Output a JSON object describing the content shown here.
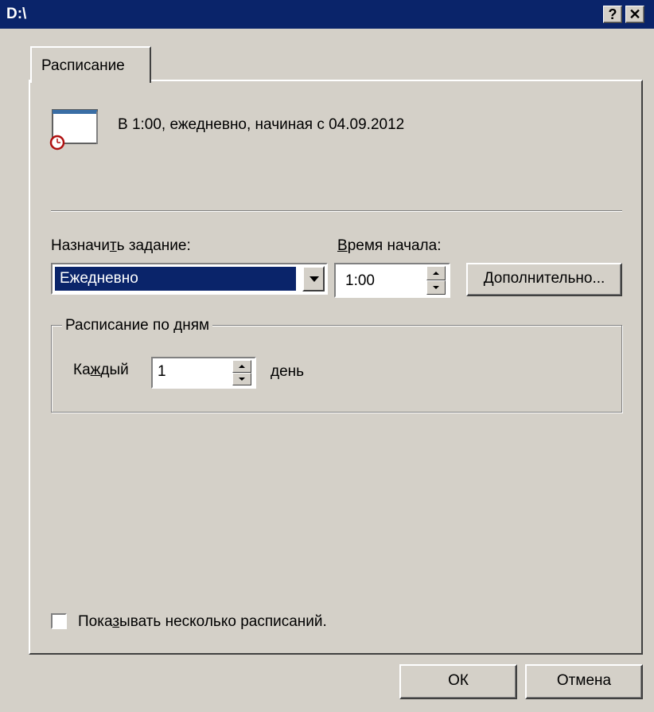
{
  "window": {
    "title": "D:\\",
    "help_label": "?",
    "close_label": "✕"
  },
  "tabs": [
    {
      "label": "Расписание"
    }
  ],
  "summary": {
    "text": "В 1:00, ежедневно, начиная с 04.09.2012",
    "icon": "schedule-clock-icon"
  },
  "assign": {
    "label_before": "Назначи",
    "label_accel": "т",
    "label_after": "ь задание:",
    "value": "Ежедневно"
  },
  "start_time": {
    "label_accel": "В",
    "label_after": "ремя начала:",
    "value": "1:00"
  },
  "advanced": {
    "label_accel": "Д",
    "label_after": "ополнительно..."
  },
  "daily": {
    "group_title": "Расписание по дням",
    "every_before": "Ка",
    "every_accel": "ж",
    "every_after": "дый",
    "every_value": "1",
    "unit": "день"
  },
  "multiple": {
    "label_before": "Пока",
    "label_accel": "з",
    "label_after": "ывать несколько расписаний.",
    "checked": false
  },
  "buttons": {
    "ok": "ОК",
    "cancel": "Отмена"
  },
  "colors": {
    "titlebar": "#0a246a",
    "face": "#d4d0c8",
    "selection": "#0a246a"
  }
}
